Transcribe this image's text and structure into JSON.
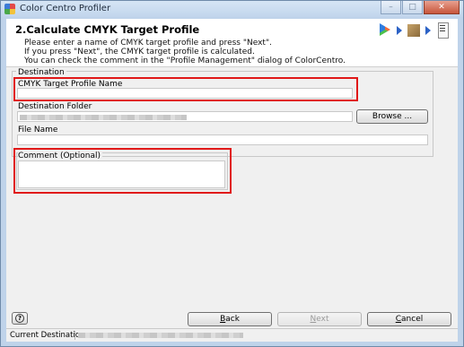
{
  "window": {
    "title": "Color Centro Profiler"
  },
  "window_buttons": {
    "minimize": "–",
    "maximize": "□",
    "close": "✕"
  },
  "header": {
    "step_title": "2.Calculate CMYK Target Profile",
    "instructions": [
      "Please enter a name of CMYK target profile and press \"Next\".",
      "If you press \"Next\", the CMYK target profile is calculated.",
      "You can check the comment in the \"Profile Management\" dialog of ColorCentro."
    ],
    "step_icons": [
      "wizard-step-1-icon",
      "wizard-step-2-icon",
      "wizard-step-3-icon"
    ]
  },
  "destination": {
    "group_label": "Destination",
    "profile_name_label": "CMYK Target Profile Name",
    "profile_name_value": "",
    "folder_label": "Destination Folder",
    "browse_label": "Browse ...",
    "file_name_label": "File Name",
    "file_name_value": ""
  },
  "comment": {
    "label": "Comment (Optional)",
    "value": ""
  },
  "footer": {
    "help_label": "?",
    "back_prefix": "",
    "back_underline": "B",
    "back_rest": "ack",
    "next_prefix": "",
    "next_underline": "N",
    "next_rest": "ext",
    "cancel_prefix": "",
    "cancel_underline": "C",
    "cancel_rest": "ancel",
    "next_enabled": false
  },
  "status": {
    "label": "Current Destination"
  },
  "colors": {
    "highlight": "#e01818",
    "title_bar": "#c1d5ec",
    "dialog_bg": "#f0f0f0"
  }
}
